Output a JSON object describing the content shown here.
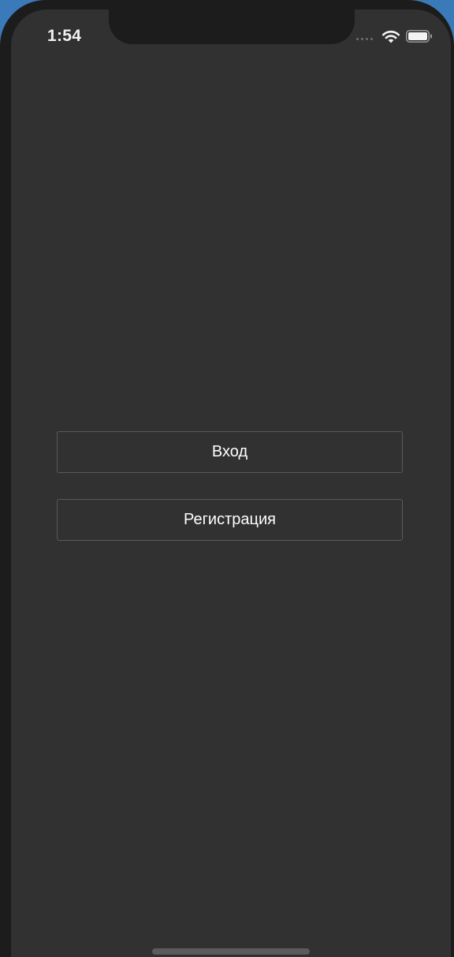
{
  "status_bar": {
    "time": "1:54",
    "icons": [
      "signal-dots-icon",
      "wifi-icon",
      "battery-icon"
    ]
  },
  "auth": {
    "login_label": "Вход",
    "register_label": "Регистрация"
  },
  "colors": {
    "screen_background": "#313131",
    "button_border": "#5a5a5a",
    "button_text": "#ffffff"
  }
}
